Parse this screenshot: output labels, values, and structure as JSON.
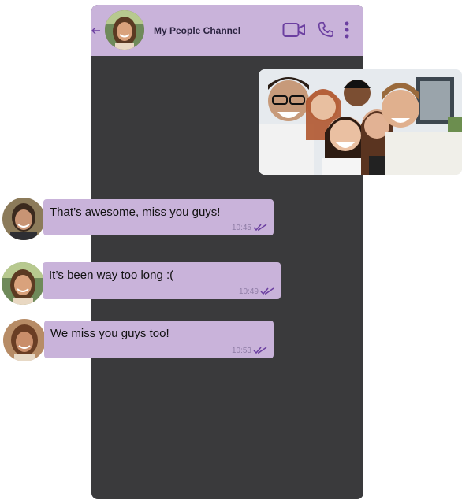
{
  "chat": {
    "title": "My People Channel",
    "icons": {
      "back": "back-arrow-icon",
      "video": "video-camera-icon",
      "call": "phone-icon",
      "menu": "more-vertical-icon"
    },
    "accent_color": "#6b3fa0",
    "header_color": "#c9b3da",
    "background_color": "#3a3a3c"
  },
  "messages": [
    {
      "text": "That’s awesome, miss you guys!",
      "time": "10:45",
      "status": "read"
    },
    {
      "text": "It’s been way too long :(",
      "time": "10:49",
      "status": "read"
    },
    {
      "text": "We miss you guys too!",
      "time": "10:53",
      "status": "read"
    }
  ]
}
